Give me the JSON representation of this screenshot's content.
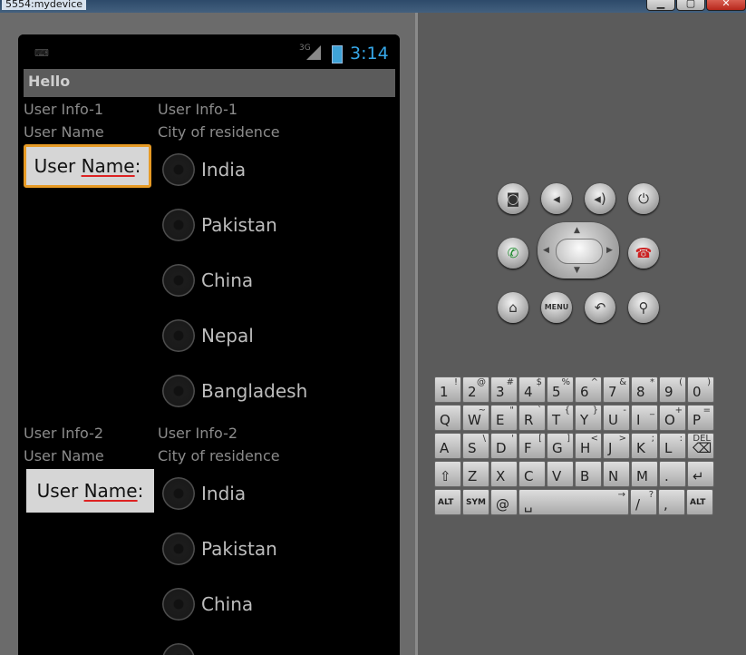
{
  "window": {
    "title": "5554:mydevice",
    "buttons": [
      "▁",
      "▢",
      "✕"
    ]
  },
  "status_bar": {
    "network": "3G",
    "time": "3:14"
  },
  "app_bar": {
    "title": "Hello"
  },
  "sections": [
    {
      "user_info_label": "User Info-1",
      "city_info_label": "User Info-1",
      "user_name_caption": "User Name",
      "city_caption": "City of residence",
      "name_field": {
        "prefix": "User ",
        "underlined": "Name",
        "suffix": ":"
      },
      "focused": true,
      "cities": [
        "India",
        "Pakistan",
        "China",
        "Nepal",
        "Bangladesh"
      ]
    },
    {
      "user_info_label": "User Info-2",
      "city_info_label": "User Info-2",
      "user_name_caption": "User Name",
      "city_caption": "City of residence",
      "name_field": {
        "prefix": "User ",
        "underlined": "Name",
        "suffix": ":"
      },
      "focused": false,
      "cities": [
        "India",
        "Pakistan",
        "China"
      ]
    }
  ],
  "controls": {
    "menu_label": "MENU",
    "icons": [
      "camera-icon",
      "volume-down-icon",
      "volume-up-icon",
      "power-icon",
      "call-icon",
      "end-call-icon",
      "home-icon",
      "menu-icon",
      "back-icon",
      "search-icon"
    ]
  },
  "keyboard": {
    "rows": [
      [
        [
          "1",
          "!"
        ],
        [
          "2",
          "@"
        ],
        [
          "3",
          "#"
        ],
        [
          "4",
          "$"
        ],
        [
          "5",
          "%"
        ],
        [
          "6",
          "^"
        ],
        [
          "7",
          "&"
        ],
        [
          "8",
          "*"
        ],
        [
          "9",
          "("
        ],
        [
          "0",
          ")"
        ]
      ],
      [
        [
          "Q",
          ""
        ],
        [
          "W",
          "~"
        ],
        [
          "E",
          "\""
        ],
        [
          "R",
          "`"
        ],
        [
          "T",
          "{"
        ],
        [
          "Y",
          "}"
        ],
        [
          "U",
          "-"
        ],
        [
          "I",
          "_"
        ],
        [
          "O",
          "+"
        ],
        [
          "P",
          "="
        ]
      ],
      [
        [
          "A",
          ""
        ],
        [
          "S",
          "\\"
        ],
        [
          "D",
          "'"
        ],
        [
          "F",
          "["
        ],
        [
          "G",
          "]"
        ],
        [
          "H",
          "<"
        ],
        [
          "J",
          ">"
        ],
        [
          "K",
          ";"
        ],
        [
          "L",
          ":"
        ],
        [
          "⌫",
          "DEL"
        ]
      ],
      [
        [
          "⇧",
          ""
        ],
        [
          "Z",
          ""
        ],
        [
          "X",
          ""
        ],
        [
          "C",
          ""
        ],
        [
          "V",
          ""
        ],
        [
          "B",
          ""
        ],
        [
          "N",
          ""
        ],
        [
          "M",
          ""
        ],
        [
          ".",
          ""
        ],
        [
          "↵",
          ""
        ]
      ]
    ],
    "bottom_row": [
      [
        "ALT",
        ""
      ],
      [
        "SYM",
        ""
      ],
      [
        "@",
        ""
      ],
      [
        "␣",
        "→"
      ],
      [
        "/",
        "?"
      ],
      [
        ",",
        ""
      ],
      [
        "ALT",
        ""
      ]
    ]
  }
}
